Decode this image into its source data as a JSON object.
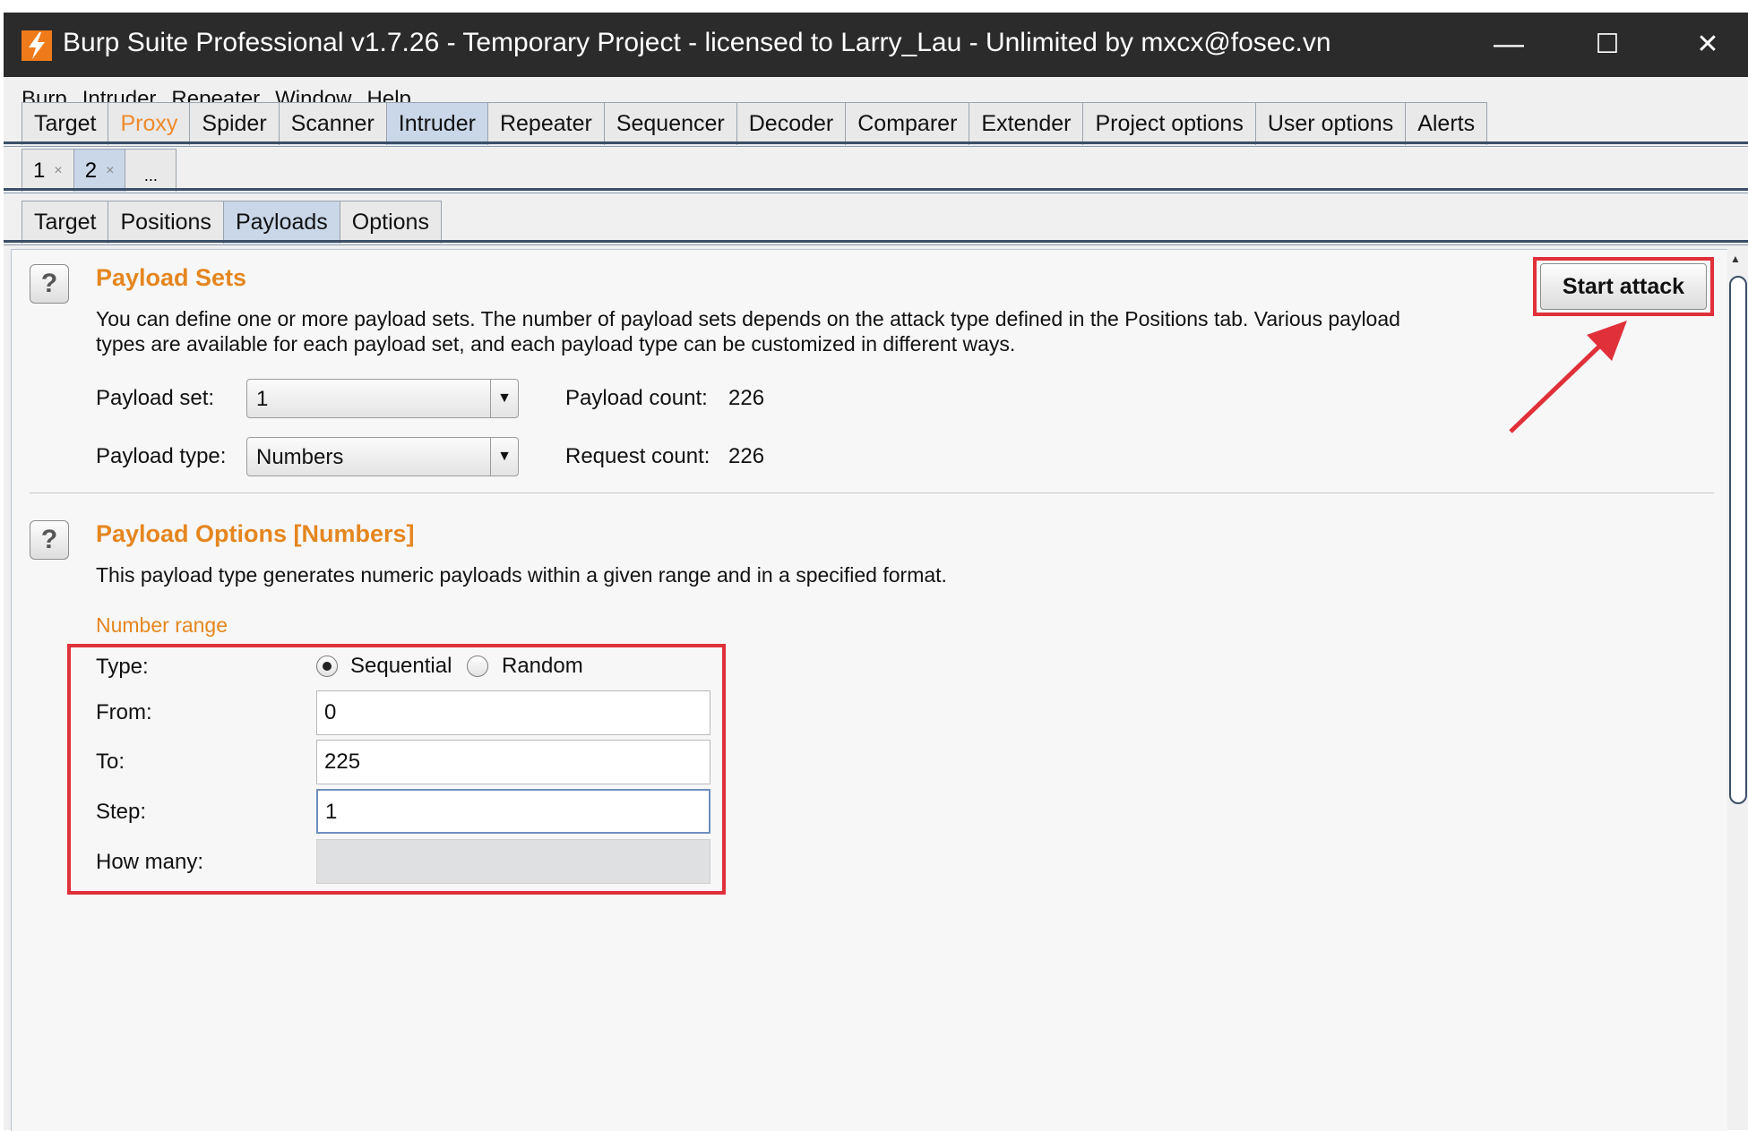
{
  "window": {
    "title": "Burp Suite Professional v1.7.26 - Temporary Project - licensed to Larry_Lau - Unlimited by mxcx@fosec.vn",
    "controls": {
      "minimize": "—",
      "maximize": "☐",
      "close": "✕"
    }
  },
  "menu": [
    "Burp",
    "Intruder",
    "Repeater",
    "Window",
    "Help"
  ],
  "main_tabs": [
    "Target",
    "Proxy",
    "Spider",
    "Scanner",
    "Intruder",
    "Repeater",
    "Sequencer",
    "Decoder",
    "Comparer",
    "Extender",
    "Project options",
    "User options",
    "Alerts"
  ],
  "attack_tabs": [
    {
      "label": "1",
      "close": "×"
    },
    {
      "label": "2",
      "close": "×"
    },
    {
      "label": "...",
      "close": ""
    }
  ],
  "sub_tabs": [
    "Target",
    "Positions",
    "Payloads",
    "Options"
  ],
  "payload_sets": {
    "help": "?",
    "heading": "Payload Sets",
    "desc_line1": "You can define one or more payload sets. The number of payload sets depends on the attack type defined in the Positions tab. Various payload",
    "desc_line2": "types are available for each payload set, and each payload type can be customized in different ways.",
    "set_label": "Payload set:",
    "set_value": "1",
    "type_label": "Payload type:",
    "type_value": "Numbers",
    "count_label": "Payload count:",
    "count_value": "226",
    "request_label": "Request count:",
    "request_value": "226",
    "start_button": "Start attack"
  },
  "payload_options": {
    "help": "?",
    "heading": "Payload Options [Numbers]",
    "desc": "This payload type generates numeric payloads within a given range and in a specified format.",
    "section": "Number range",
    "type_label": "Type:",
    "sequential": "Sequential",
    "random": "Random",
    "from_label": "From:",
    "from_value": "0",
    "to_label": "To:",
    "to_value": "225",
    "step_label": "Step:",
    "step_value": "1",
    "howmany_label": "How many:",
    "howmany_value": ""
  },
  "colors": {
    "accent": "#e5861f",
    "highlight": "#e0303a",
    "selected_tab": "#c9d7e8"
  }
}
